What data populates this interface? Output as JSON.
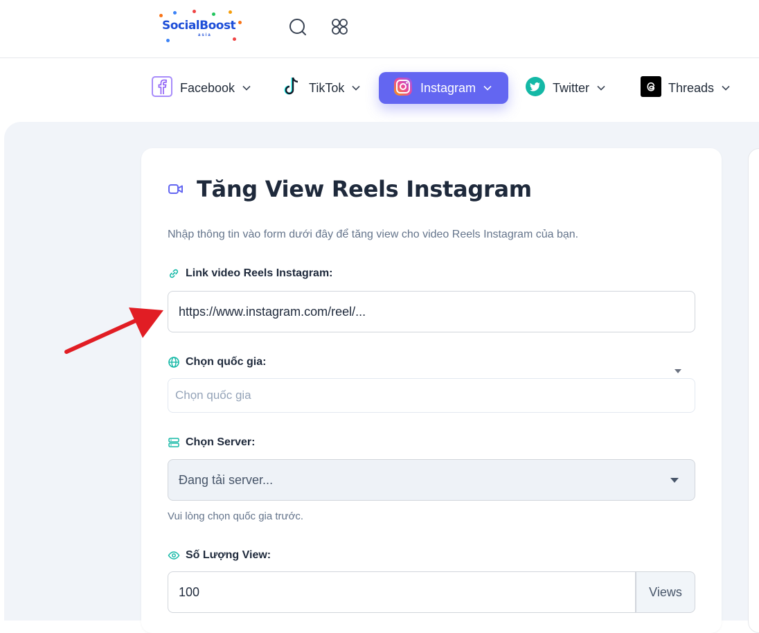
{
  "header": {
    "logo_text": "SocialBoost",
    "logo_sub": "asia",
    "icons": [
      "search-icon",
      "apps-grid-icon"
    ]
  },
  "nav": {
    "items": [
      {
        "label": "Facebook",
        "icon": "facebook-icon",
        "active": false
      },
      {
        "label": "TikTok",
        "icon": "tiktok-icon",
        "active": false
      },
      {
        "label": "Instagram",
        "icon": "instagram-icon",
        "active": true
      },
      {
        "label": "Twitter",
        "icon": "twitter-icon",
        "active": false
      },
      {
        "label": "Threads",
        "icon": "threads-icon",
        "active": false
      }
    ]
  },
  "form": {
    "title": "Tăng View Reels Instagram",
    "description": "Nhập thông tin vào form dưới đây để tăng view cho video Reels Instagram của bạn.",
    "link_label": "Link video Reels Instagram:",
    "link_value": "https://www.instagram.com/reel/...",
    "country_label": "Chọn quốc gia:",
    "country_placeholder": "Chọn quốc gia",
    "server_label": "Chọn Server:",
    "server_value": "Đang tải server...",
    "server_hint": "Vui lòng chọn quốc gia trước.",
    "quantity_label": "Số Lượng View:",
    "quantity_value": "100",
    "quantity_unit": "Views"
  },
  "colors": {
    "accent": "#6366f1",
    "teal": "#14b8a6",
    "arrow": "#e11d24"
  }
}
